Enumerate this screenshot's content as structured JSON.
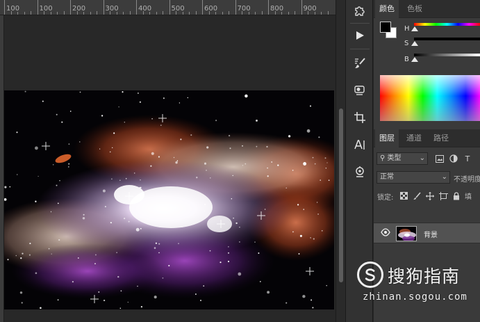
{
  "ruler": {
    "labels": [
      "100",
      "100",
      "200",
      "300",
      "400",
      "500",
      "600",
      "700",
      "800",
      "900"
    ]
  },
  "document": {
    "image_description_icon": "nebula-canvas-image"
  },
  "tools": [
    {
      "name": "puzzle-icon"
    },
    {
      "name": "play-icon"
    },
    {
      "name": "brush-settings-icon"
    },
    {
      "name": "clone-source-icon"
    },
    {
      "name": "crop-icon"
    },
    {
      "name": "character-icon"
    },
    {
      "name": "puppet-icon"
    }
  ],
  "color_panel": {
    "tabs": [
      "颜色",
      "色板"
    ],
    "active_tab": "颜色",
    "foreground": "#000000",
    "background": "#ffffff",
    "sliders": [
      {
        "label": "H",
        "value": 0
      },
      {
        "label": "S",
        "value": 0
      },
      {
        "label": "B",
        "value": 0
      }
    ]
  },
  "layers_panel": {
    "tabs": [
      "图层",
      "通道",
      "路径"
    ],
    "active_tab": "图层",
    "filter_kind": "类型",
    "blend_mode": "正常",
    "opacity_label": "不透明度",
    "lock_label": "锁定:",
    "fill_label": "填",
    "layers": [
      {
        "name": "背景",
        "visible": true
      }
    ]
  },
  "watermark": {
    "brand": "搜狗指南",
    "url": "zhinan.sogou.com"
  }
}
